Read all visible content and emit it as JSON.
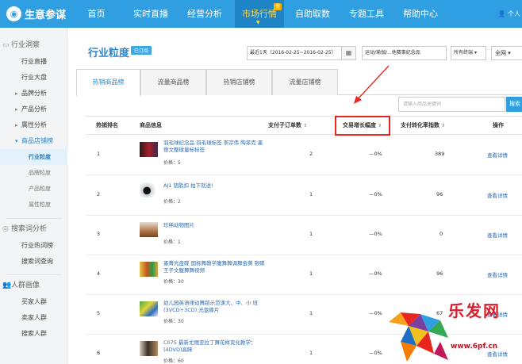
{
  "app": {
    "logo": "生意参谋",
    "logo_icon": "compass-icon",
    "user": "个人"
  },
  "nav": [
    {
      "label": "首页"
    },
    {
      "label": "实时直播"
    },
    {
      "label": "经营分析"
    },
    {
      "label": "市场行情",
      "badge": "专",
      "active": true
    },
    {
      "label": "自助取数"
    },
    {
      "label": "专题工具"
    },
    {
      "label": "帮助中心"
    }
  ],
  "sidebar": {
    "sec1": "行业洞察",
    "l1": "行业直播",
    "l2": "行业大盘",
    "l3": "品牌分析",
    "l4": "产品分析",
    "l5": "属性分析",
    "l6": "商品店铺榜",
    "s1": "行业粒度",
    "s2": "品牌粒度",
    "s3": "产品粒度",
    "s4": "属性粒度",
    "sec2": "搜索词分析",
    "l7": "行业热词榜",
    "l8": "搜索词查询",
    "sec3": "人群画像",
    "l9": "买家人群",
    "l10": "卖家人群",
    "l11": "搜索人群"
  },
  "main": {
    "title": "行业粒度",
    "tag": "已订阅",
    "date_range": "最近1天（2016-02-25~2016-02-25）",
    "category": "运动/瑜伽/...他赛事纪念品",
    "terminal": "所有终端",
    "scope": "全网"
  },
  "tabs": [
    "热销商品榜",
    "流量商品榜",
    "热销店铺榜",
    "流量店铺榜"
  ],
  "search": {
    "placeholder": "请输入商品关键词",
    "button": "搜索"
  },
  "table": {
    "headers": [
      "热销排名",
      "商品信息",
      "支付子订单数",
      "交易增长幅度",
      "支付转化率指数",
      "操作"
    ],
    "detail_label": "查看详情",
    "rows": [
      {
        "rank": "1",
        "title": "羽毛球纪念品 羽毛球标签 李宗伟 陶菲克 墨德文整球量标标签",
        "price": "价格：5",
        "orders": "2",
        "growth": "—0%",
        "conv": "389"
      },
      {
        "rank": "2",
        "title": "AJ1 钥匙扣 拍下就送!",
        "price": "价格：2",
        "orders": "1",
        "growth": "—0%",
        "conv": "96"
      },
      {
        "rank": "3",
        "title": "珍稀动物图片",
        "price": "价格：1",
        "orders": "1",
        "growth": "—0%",
        "conv": "0"
      },
      {
        "rank": "4",
        "title": "墨菁光盘碟 国标舞教学腹舞舞调舞金黄 银碟 王子文腹舞舞视频",
        "price": "价格：30",
        "orders": "1",
        "growth": "—0%",
        "conv": "96"
      },
      {
        "rank": "5",
        "title": "幼儿园英语律动舞蹈示范课大、中、小 班(3VCD+3CD) 光盘碟片",
        "price": "价格：30",
        "orders": "1",
        "growth": "—0%",
        "conv": "67"
      },
      {
        "rank": "6",
        "title": "C075 最新尤丽亚拉丁舞花样变化教学：(4DVD)高睐",
        "price": "价格：60",
        "orders": "1",
        "growth": "—0%",
        "conv": "96"
      }
    ]
  },
  "watermark": {
    "text": "乐发网",
    "url": "www.6pf.cn"
  }
}
